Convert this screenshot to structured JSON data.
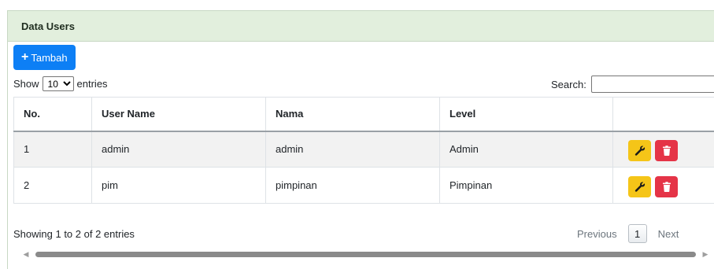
{
  "panel": {
    "title": "Data Users"
  },
  "toolbar": {
    "add_label": "Tambah",
    "add_icon": "plus-icon"
  },
  "length": {
    "prefix": "Show",
    "value": "10",
    "suffix": "entries",
    "options": [
      "10"
    ]
  },
  "search": {
    "label": "Search:",
    "value": "",
    "placeholder": ""
  },
  "table": {
    "columns": [
      "No.",
      "User Name",
      "Nama",
      "Level",
      ""
    ],
    "rows": [
      {
        "no": "1",
        "username": "admin",
        "nama": "admin",
        "level": "Admin",
        "edit_icon": "wrench-icon",
        "delete_icon": "trash-icon"
      },
      {
        "no": "2",
        "username": "pim",
        "nama": "pimpinan",
        "level": "Pimpinan",
        "edit_icon": "wrench-icon",
        "delete_icon": "trash-icon"
      }
    ]
  },
  "info": {
    "text": "Showing 1 to 2 of 2 entries"
  },
  "pagination": {
    "previous": "Previous",
    "current_page": "1",
    "next": "Next"
  },
  "colors": {
    "header_bg": "#e2efdd",
    "primary": "#0d7ff5",
    "warning": "#f5c518",
    "danger": "#e53447"
  }
}
